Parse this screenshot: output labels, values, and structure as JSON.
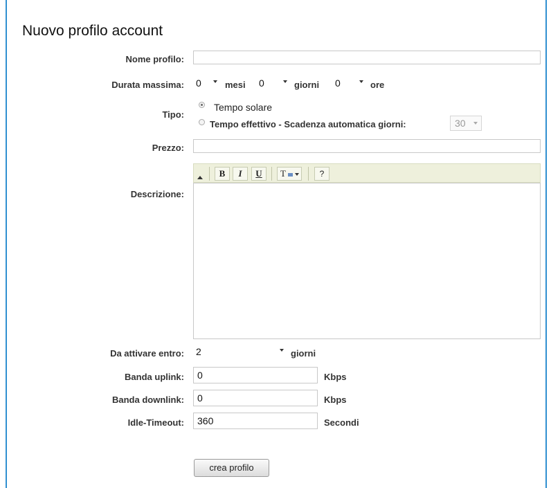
{
  "form": {
    "title": "Nuovo profilo account",
    "nome_profilo": {
      "label": "Nome profilo:",
      "value": ""
    },
    "durata": {
      "label": "Durata massima:",
      "mesi_value": "0",
      "mesi_unit": "mesi",
      "giorni_value": "0",
      "giorni_unit": "giorni",
      "ore_value": "0",
      "ore_unit": "ore"
    },
    "tipo": {
      "label": "Tipo:",
      "option1": "Tempo solare",
      "option2": "Tempo effettivo - Scadenza automatica giorni:",
      "selected": "option1",
      "scadenza_value": "30"
    },
    "prezzo": {
      "label": "Prezzo:",
      "value": ""
    },
    "descrizione": {
      "label": "Descrizione:",
      "toolbar": {
        "bold": "B",
        "italic": "I",
        "underline": "U",
        "font_color": "T",
        "help": "?"
      }
    },
    "attivazione": {
      "label": "Da attivare entro:",
      "value": "2",
      "unit": "giorni"
    },
    "uplink": {
      "label": "Banda uplink:",
      "value": "0",
      "unit": "Kbps"
    },
    "downlink": {
      "label": "Banda downlink:",
      "value": "0",
      "unit": "Kbps"
    },
    "idle": {
      "label": "Idle-Timeout:",
      "value": "360",
      "unit": "Secondi"
    },
    "submit_label": "crea profilo"
  },
  "colors": {
    "frame": "#2f8fd0",
    "toolbar_bg": "#eef0dc"
  }
}
